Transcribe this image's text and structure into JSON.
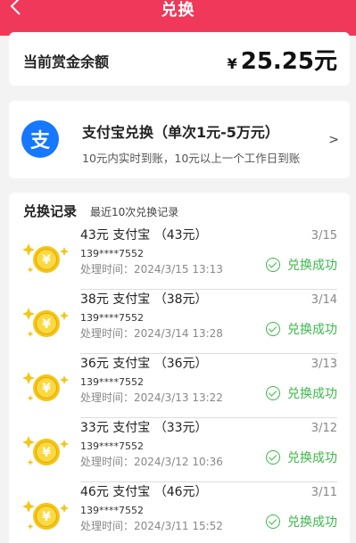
{
  "header": {
    "title": "兑换"
  },
  "balance": {
    "label": "当前赏金余额",
    "currency_symbol": "¥",
    "amount": "25.25元"
  },
  "alipay": {
    "logo_char": "支",
    "title": "支付宝兑换（单次1元-5万元）",
    "desc": "10元内实时到账，10元以上一个工作日到账",
    "chevron": ">"
  },
  "records": {
    "title": "兑换记录",
    "subtitle": "最近10次兑换记录",
    "items": [
      {
        "title": "43元 支付宝 （43元）",
        "phone": "139****7552",
        "time": "处理时间：2024/3/15 13:13",
        "date": "3/15",
        "status": "兑换成功"
      },
      {
        "title": "38元 支付宝 （38元）",
        "phone": "139****7552",
        "time": "处理时间：2024/3/14 13:28",
        "date": "3/14",
        "status": "兑换成功"
      },
      {
        "title": "36元 支付宝 （36元）",
        "phone": "139****7552",
        "time": "处理时间：2024/3/13 13:22",
        "date": "3/13",
        "status": "兑换成功"
      },
      {
        "title": "33元 支付宝 （33元）",
        "phone": "139****7552",
        "time": "处理时间：2024/3/12 10:36",
        "date": "3/12",
        "status": "兑换成功"
      },
      {
        "title": "46元 支付宝 （46元）",
        "phone": "139****7552",
        "time": "处理时间：2024/3/11 15:52",
        "date": "3/11",
        "status": "兑换成功"
      }
    ]
  },
  "colors": {
    "header_bg": "#f0395a",
    "success": "#3db84a",
    "alipay_blue": "#1677ff",
    "coin_gold": "#f5c518"
  }
}
